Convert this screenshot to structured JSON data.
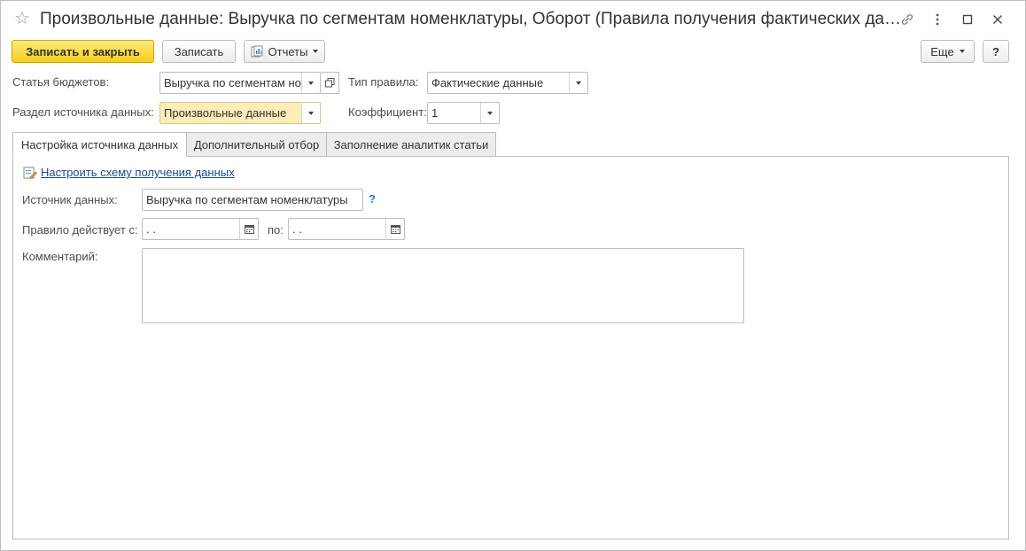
{
  "window": {
    "title": "Произвольные данные: Выручка по сегментам номенклатуры, Оборот (Правила получения фактических данн...",
    "favorite_icon": "star-icon",
    "icons": [
      "link-icon",
      "more-vertical-icon",
      "maximize-icon",
      "close-icon"
    ]
  },
  "toolbar": {
    "save_close_label": "Записать и закрыть",
    "save_label": "Записать",
    "reports_label": "Отчеты",
    "more_label": "Еще",
    "help_label": "?"
  },
  "form": {
    "budget_item_label": "Статья бюджетов:",
    "budget_item_value": "Выручка по сегментам но",
    "rule_type_label": "Тип правила:",
    "rule_type_value": "Фактические данные",
    "source_section_label": "Раздел источника данных:",
    "source_section_value": "Произвольные данные",
    "coefficient_label": "Коэффициент:",
    "coefficient_value": "1"
  },
  "tabs": [
    {
      "label": "Настройка источника данных",
      "active": true
    },
    {
      "label": "Дополнительный отбор",
      "active": false
    },
    {
      "label": "Заполнение аналитик статьи",
      "active": false
    }
  ],
  "panel": {
    "configure_link": "Настроить схему получения данных",
    "data_source_label": "Источник данных:",
    "data_source_value": "Выручка по сегментам номенклатуры",
    "help_mark": "?",
    "valid_from_label": "Правило действует с:",
    "valid_from_value": " .  .",
    "valid_to_label": "по:",
    "valid_to_value": " .  .",
    "comment_label": "Комментарий:",
    "comment_value": ""
  },
  "colors": {
    "primary_button": "#f4cf1c",
    "highlight_field": "#fcecb8",
    "link": "#1a4a8c",
    "help": "#1a7fd4"
  }
}
